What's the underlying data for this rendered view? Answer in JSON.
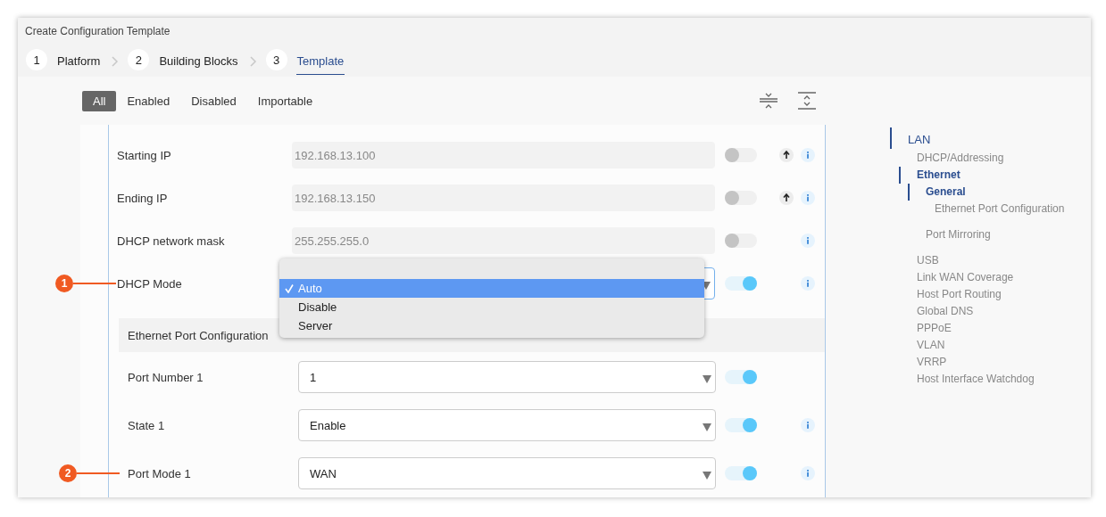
{
  "window": {
    "title": "Create Configuration Template"
  },
  "steps": [
    {
      "number": "1",
      "label": "Platform",
      "selected": false
    },
    {
      "number": "2",
      "label": "Building Blocks",
      "selected": false
    },
    {
      "number": "3",
      "label": "Template",
      "selected": true
    }
  ],
  "filters": [
    {
      "label": "All",
      "selected": true
    },
    {
      "label": "Enabled",
      "selected": false
    },
    {
      "label": "Disabled",
      "selected": false
    },
    {
      "label": "Importable",
      "selected": false
    }
  ],
  "rows": [
    {
      "kind": "text",
      "label": "Starting IP",
      "value": "192.168.13.100",
      "enabled": false,
      "upload": true,
      "info": true
    },
    {
      "kind": "text",
      "label": "Ending IP",
      "value": "192.168.13.150",
      "enabled": false,
      "upload": true,
      "info": true
    },
    {
      "kind": "text",
      "label": "DHCP network mask",
      "value": "255.255.255.0",
      "enabled": false,
      "upload": false,
      "info": true
    },
    {
      "kind": "select",
      "label": "DHCP Mode",
      "enabled": true,
      "upload": false,
      "info": true,
      "callout": "1",
      "menu": [
        {
          "label": "Auto",
          "selected": true
        },
        {
          "label": "Disable",
          "selected": false
        },
        {
          "label": "Server",
          "selected": false
        }
      ]
    }
  ],
  "section": {
    "title": "Ethernet Port Configuration",
    "rows": [
      {
        "kind": "select",
        "label": "Port Number 1",
        "value": "1",
        "enabled": true,
        "info": false
      },
      {
        "kind": "select",
        "label": "State 1",
        "value": "Enable",
        "enabled": true,
        "info": true
      },
      {
        "kind": "select",
        "label": "Port Mode 1",
        "value": "WAN",
        "enabled": true,
        "info": true,
        "callout": "2"
      }
    ]
  },
  "nav": [
    {
      "label": "LAN",
      "selected": true,
      "children": [
        {
          "label": "DHCP/Addressing",
          "selected": false
        },
        {
          "label": "Ethernet",
          "selected": true,
          "children": [
            {
              "label": "General",
              "selected": true,
              "children": [
                {
                  "label": "Ethernet Port Configuration",
                  "selected": false
                }
              ]
            },
            {
              "label": "Port Mirroring",
              "selected": false
            }
          ]
        },
        {
          "label": "USB",
          "selected": false
        },
        {
          "label": "Link WAN Coverage",
          "selected": false
        },
        {
          "label": "Host Port Routing",
          "selected": false
        },
        {
          "label": "Global DNS",
          "selected": false
        },
        {
          "label": "PPPoE",
          "selected": false
        },
        {
          "label": "VLAN",
          "selected": false
        },
        {
          "label": "VRRP",
          "selected": false
        },
        {
          "label": "Host Interface Watchdog",
          "selected": false
        }
      ]
    }
  ]
}
